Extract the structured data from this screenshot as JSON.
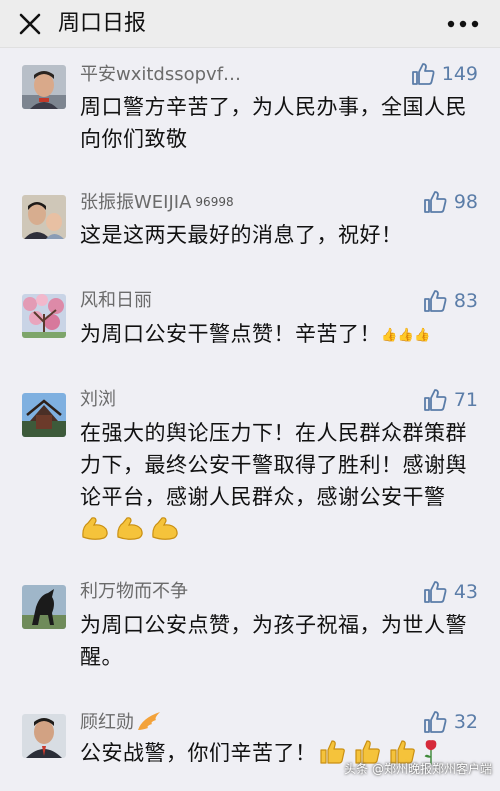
{
  "header": {
    "title": "周口日报"
  },
  "comments": [
    {
      "nick": "平安wxitdssopvf…",
      "tag": "",
      "likes": "149",
      "text": "周口警方辛苦了，为人民办事，全国人民向你们致敬",
      "emoji_text": ""
    },
    {
      "nick": "张振振WEIJIA",
      "tag": "96998",
      "likes": "98",
      "text": "这是这两天最好的消息了，祝好！",
      "emoji_text": ""
    },
    {
      "nick": "风和日丽",
      "tag": "",
      "likes": "83",
      "text": "为周口公安干警点赞！辛苦了！",
      "emoji_text": "👍👍👍"
    },
    {
      "nick": "刘浏",
      "tag": "",
      "likes": "71",
      "text": "在强大的舆论压力下！在人民群众群策群力下，最终公安干警取得了胜利！感谢舆论平台，感谢人民群众，感谢公安干警",
      "emoji_text": ""
    },
    {
      "nick": "利万物而不争",
      "tag": "",
      "likes": "43",
      "text": "为周口公安点赞，为孩子祝福，为世人警醒。",
      "emoji_text": ""
    },
    {
      "nick": "顾红勋",
      "tag": "",
      "likes": "32",
      "text": "公安战警，你们辛苦了！",
      "emoji_text": ""
    }
  ],
  "watermark": "头条 @郑州晚报郑州客户端",
  "icons": {
    "close": "close-icon",
    "more": "more-icon",
    "like": "thumbs-up-icon",
    "flex": "flexed-biceps-emoji",
    "thumb": "thumbs-up-emoji",
    "rose": "rose-emoji",
    "vip": "wing-badge-icon"
  },
  "colors": {
    "accent": "#5b7da8",
    "background": "#efeff4"
  }
}
